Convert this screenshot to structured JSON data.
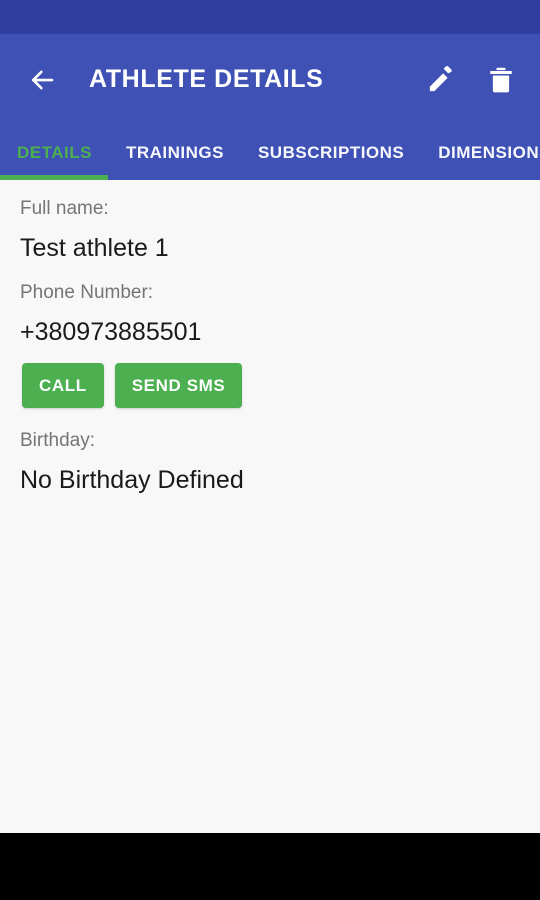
{
  "status_bar": {
    "background_color": "#303f9f"
  },
  "app_bar": {
    "title": "ATHLETE DETAILS",
    "background_color": "#3f51b5",
    "back_icon": "arrow-left-icon",
    "actions": [
      {
        "name": "edit",
        "icon": "pencil-icon"
      },
      {
        "name": "delete",
        "icon": "trash-icon"
      }
    ]
  },
  "tabs": {
    "active_index": 0,
    "active_color": "#4caf50",
    "items": [
      {
        "label": "DETAILS"
      },
      {
        "label": "TRAININGS"
      },
      {
        "label": "SUBSCRIPTIONS"
      },
      {
        "label": "DIMENSIONS"
      }
    ]
  },
  "details": {
    "full_name": {
      "label": "Full name:",
      "value": "Test athlete 1"
    },
    "phone_number": {
      "label": "Phone Number:",
      "value": "+380973885501"
    },
    "actions": {
      "call_label": "CALL",
      "sms_label": "SEND SMS",
      "button_color": "#4caf50"
    },
    "birthday": {
      "label": "Birthday:",
      "value": "No Birthday Defined"
    }
  },
  "nav_bar": {
    "background_color": "#000000"
  }
}
